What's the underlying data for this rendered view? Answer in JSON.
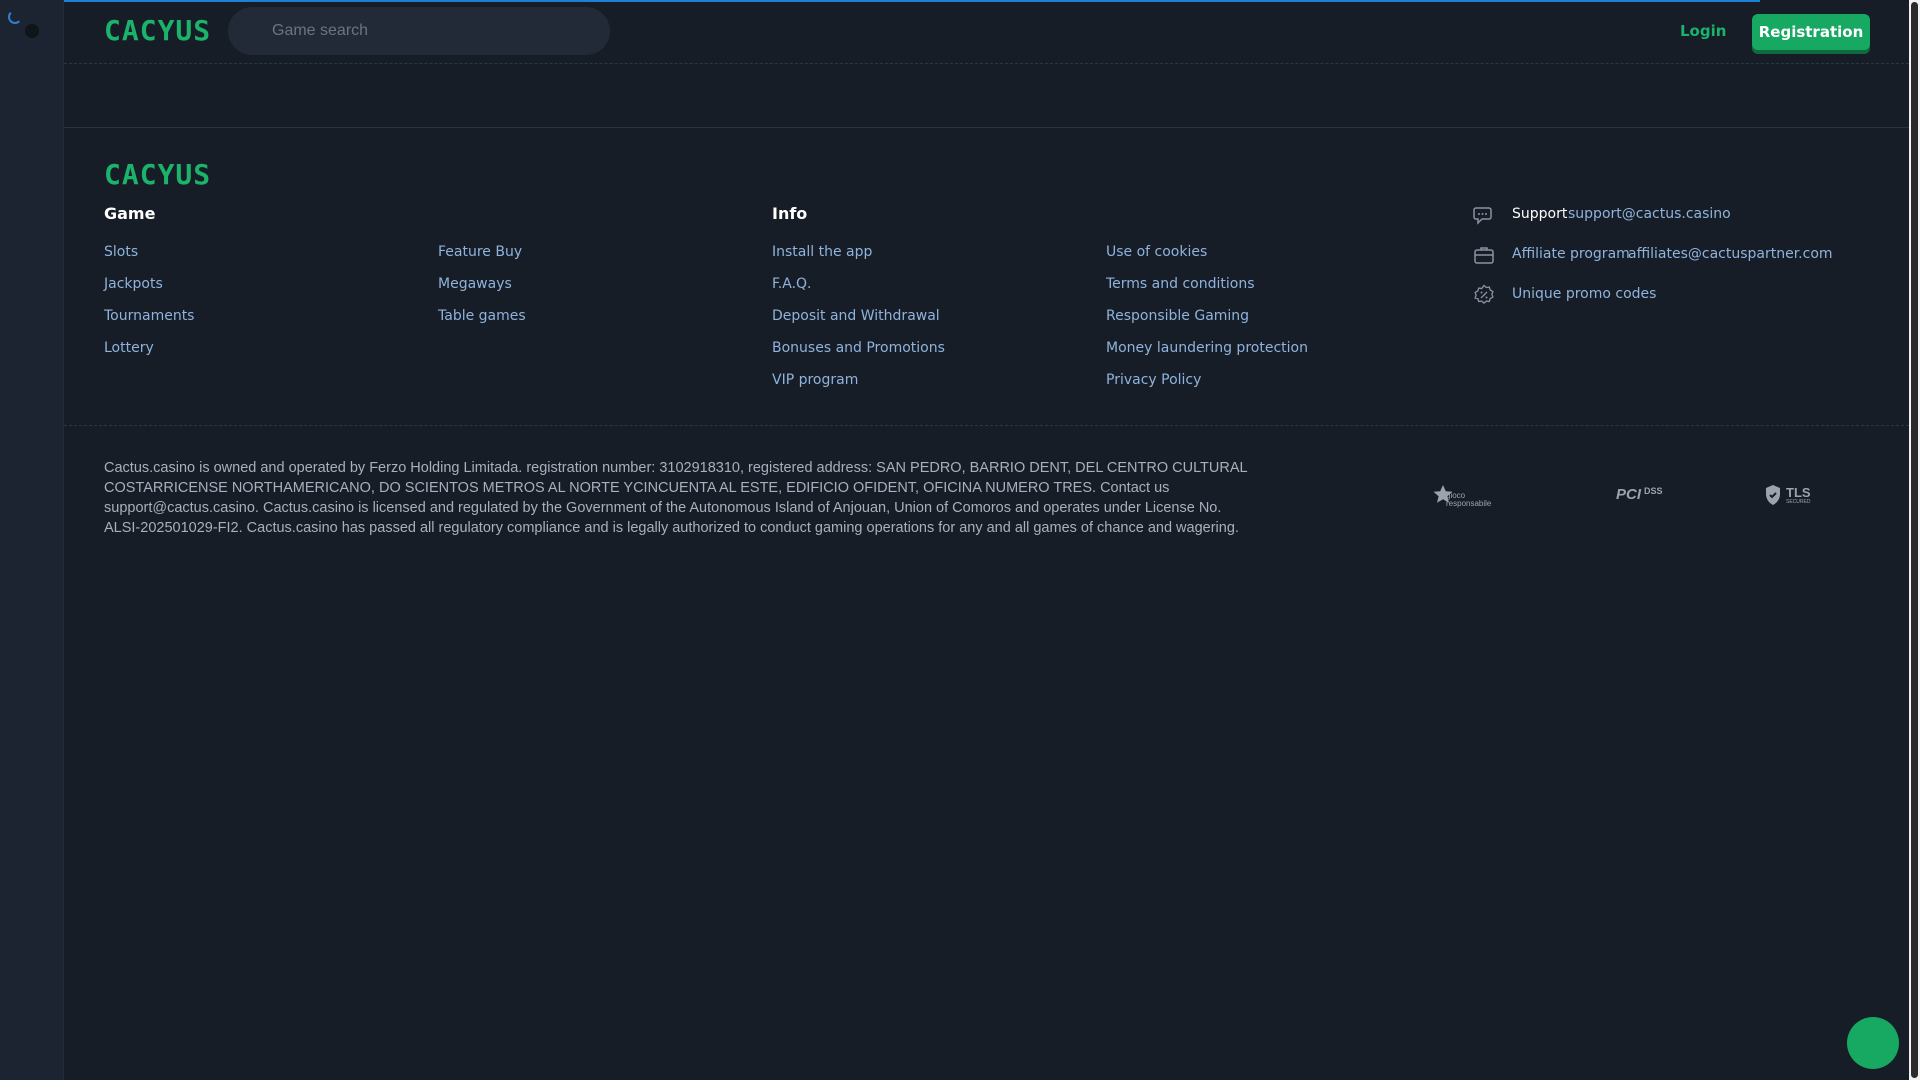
{
  "brand": {
    "logo_text": "CACYUS",
    "accent": "#1bb36b"
  },
  "header": {
    "search_placeholder": "Game search",
    "login_label": "Login",
    "register_label": "Registration"
  },
  "footer": {
    "game_title": "Game",
    "game_links_a": [
      "Slots",
      "Jackpots",
      "Tournaments",
      "Lottery"
    ],
    "game_links_b": [
      "Feature Buy",
      "Megaways",
      "Table games"
    ],
    "info_title": "Info",
    "info_links_a": [
      "Install the app",
      "F.A.Q.",
      "Deposit and Withdrawal",
      "Bonuses and Promotions",
      "VIP program"
    ],
    "info_links_b": [
      "Use of cookies",
      "Terms and conditions",
      "Responsible Gaming",
      "Money laundering protection",
      "Privacy Policy"
    ],
    "contacts": {
      "support_label": "Support",
      "support_email": "support@cactus.casino",
      "affiliate_label": "Affiliate program",
      "affiliate_email": "affiliates@cactuspartner.com",
      "promo_label": "Unique promo codes"
    },
    "legal_text": "Cactus.casino is owned and operated by Ferzo Holding Limitada. registration number: 3102918310, registered address: SAN PEDRO, BARRIO DENT, DEL CENTRO CULTURAL COSTARRICENSE NORTHAMERICANO, DO SCIENTOS METROS AL NORTE YCINCUENTA AL ESTE, EDIFICIO OFIDENT, OFICINA NUMERO TRES. Contact us support@cactus.casino. Cactus.casino is licensed and regulated by the Government of the Autonomous Island of Anjouan, Union of Comoros and operates under License No. ALSI-202501029-FI2. Cactus.casino has passed all regulatory compliance and is legally authorized to conduct gaming operations for any and all games of chance and wagering.",
    "badges": {
      "gioco": "gioco responsabile",
      "pci": "PCI",
      "dss": "DSS",
      "tls": "TLS",
      "tls_sub": "SECURED"
    }
  }
}
